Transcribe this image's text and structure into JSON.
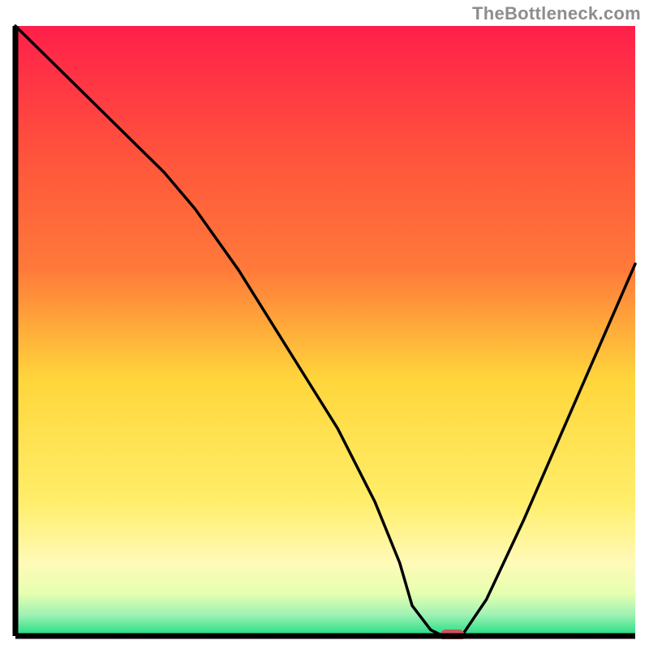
{
  "watermark": "TheBottleneck.com",
  "colors": {
    "gradient_top": "#ff1f4a",
    "gradient_mid_upper": "#ff7a3a",
    "gradient_mid": "#ffd63b",
    "gradient_low": "#fffab8",
    "gradient_bottom_band": "#e6ffb0",
    "gradient_bottom": "#1edc82",
    "curve": "#000000",
    "axis": "#000000",
    "marker": "#d0525f"
  },
  "chart_data": {
    "type": "line",
    "title": "",
    "xlabel": "",
    "ylabel": "",
    "xlim": [
      0,
      100
    ],
    "ylim": [
      0,
      100
    ],
    "series": [
      {
        "name": "curve",
        "x": [
          0,
          8,
          16,
          24,
          29,
          36,
          44,
          52,
          58,
          62,
          64,
          67,
          69,
          72,
          76,
          82,
          88,
          94,
          100
        ],
        "y": [
          100,
          92,
          84,
          76,
          70,
          60,
          47,
          34,
          22,
          12,
          5,
          1,
          0,
          0,
          6,
          19,
          33,
          47,
          61
        ]
      }
    ],
    "marker": {
      "x": 70.5,
      "y": 0
    },
    "legend": false,
    "grid": false
  }
}
